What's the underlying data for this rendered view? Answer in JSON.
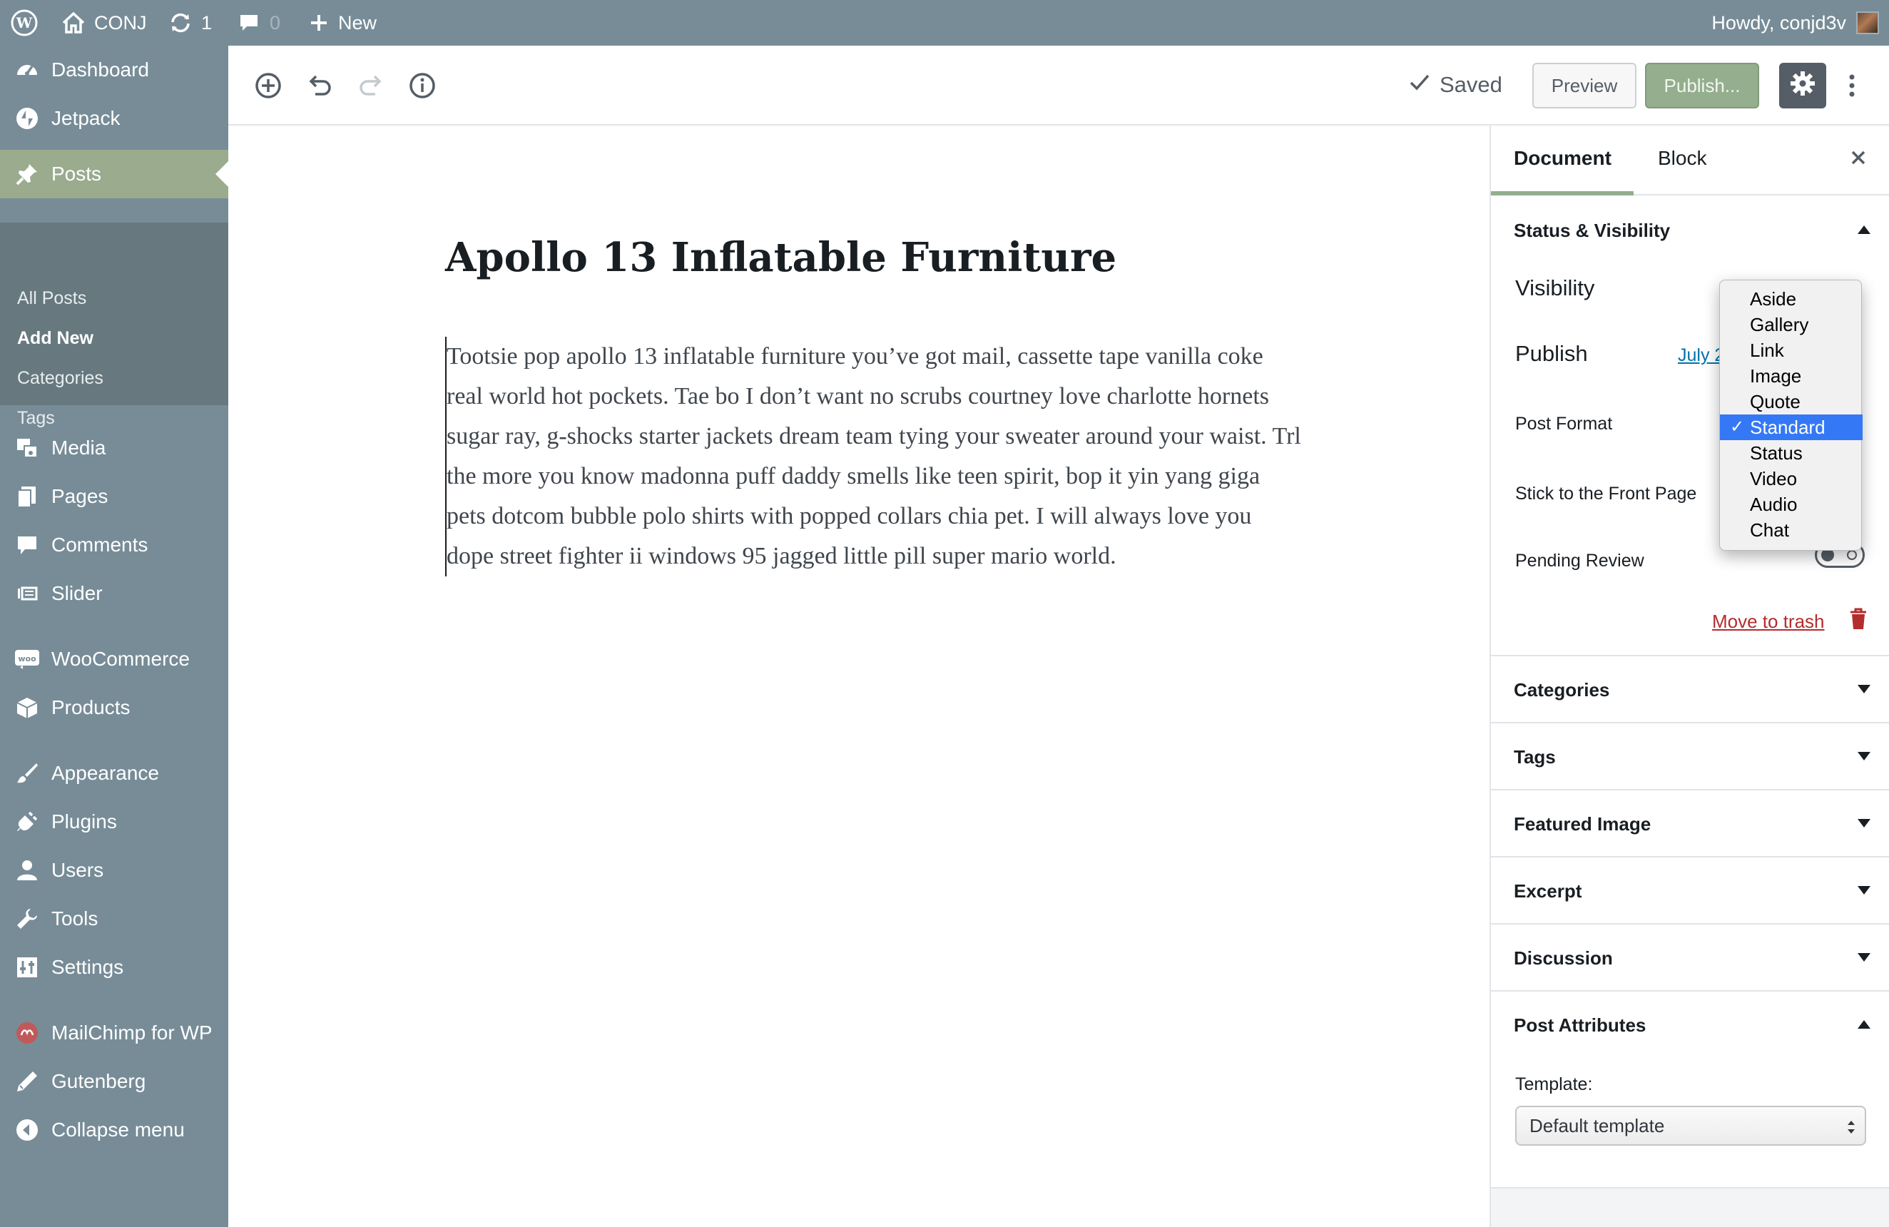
{
  "admin_bar": {
    "site_name": "CONJ",
    "updates_count": "1",
    "comments_count": "0",
    "new_label": "New",
    "howdy": "Howdy, conjd3v"
  },
  "sidebar": {
    "items": [
      {
        "label": "Dashboard",
        "icon": "dashboard-icon"
      },
      {
        "label": "Jetpack",
        "icon": "jetpack-icon"
      },
      {
        "label": "Posts",
        "icon": "pin-icon"
      },
      {
        "label": "Media",
        "icon": "media-icon"
      },
      {
        "label": "Pages",
        "icon": "pages-icon"
      },
      {
        "label": "Comments",
        "icon": "comment-icon"
      },
      {
        "label": "Slider",
        "icon": "slider-icon"
      },
      {
        "label": "WooCommerce",
        "icon": "woo-icon"
      },
      {
        "label": "Products",
        "icon": "products-icon"
      },
      {
        "label": "Appearance",
        "icon": "brush-icon"
      },
      {
        "label": "Plugins",
        "icon": "plug-icon"
      },
      {
        "label": "Users",
        "icon": "user-icon"
      },
      {
        "label": "Tools",
        "icon": "wrench-icon"
      },
      {
        "label": "Settings",
        "icon": "settings-sliders-icon"
      },
      {
        "label": "MailChimp for WP",
        "icon": "mailchimp-icon"
      },
      {
        "label": "Gutenberg",
        "icon": "pencil-icon"
      },
      {
        "label": "Collapse menu",
        "icon": "collapse-icon"
      }
    ],
    "posts_submenu": [
      "All Posts",
      "Add New",
      "Categories",
      "Tags"
    ]
  },
  "toolbar": {
    "saved_label": "Saved",
    "preview_label": "Preview",
    "publish_label": "Publish..."
  },
  "post": {
    "title": "Apollo 13 Inflatable Furniture",
    "body": "Tootsie pop apollo 13 inflatable furniture you’ve got mail, cassette tape vanilla coke real world hot pockets. Tae bo I don’t want no scrubs courtney love charlotte hornets sugar ray, g-shocks starter jackets dream team tying your sweater around your waist. Trl the more you know madonna puff daddy smells like teen spirit, bop it yin yang giga pets dotcom bubble polo shirts with popped collars chia pet. I will always love you dope street fighter ii windows 95 jagged little pill super mario world."
  },
  "settings": {
    "tabs": [
      "Document",
      "Block"
    ],
    "status_visibility": {
      "title": "Status & Visibility",
      "visibility_label": "Visibility",
      "publish_label": "Publish",
      "publish_value": "July 2",
      "post_format_label": "Post Format",
      "sticky_label": "Stick to the Front Page",
      "pending_label": "Pending Review",
      "trash_label": "Move to trash"
    },
    "panels": [
      "Categories",
      "Tags",
      "Featured Image",
      "Excerpt",
      "Discussion"
    ],
    "post_attributes": {
      "title": "Post Attributes",
      "template_label": "Template:",
      "template_value": "Default template"
    },
    "post_format_options": [
      "Aside",
      "Gallery",
      "Link",
      "Image",
      "Quote",
      "Standard",
      "Status",
      "Video",
      "Audio",
      "Chat"
    ],
    "post_format_selected": "Standard"
  },
  "colors": {
    "admin_bar": "#778c97",
    "sidebar_active": "#9aab8e",
    "primary_button": "#94ae8e",
    "link": "#0073aa",
    "trash": "#b32d2e",
    "selection": "#3478f6"
  }
}
